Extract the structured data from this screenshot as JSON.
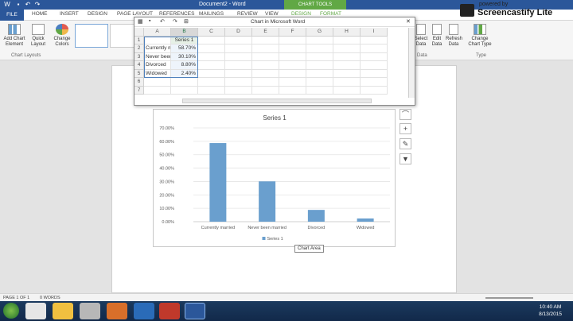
{
  "titlebar": {
    "doc_title": "Document2 - Word",
    "chart_tools": "CHART TOOLS"
  },
  "ribbon_tabs": [
    "FILE",
    "HOME",
    "INSERT",
    "DESIGN",
    "PAGE LAYOUT",
    "REFERENCES",
    "MAILINGS",
    "REVIEW",
    "VIEW",
    "DESIGN",
    "FORMAT"
  ],
  "ribbon": {
    "add_chart_element": "Add Chart Element",
    "quick_layout": "Quick Layout",
    "change_colors": "Change Colors",
    "chart_layouts_label": "Chart Layouts",
    "select_data": "Select Data",
    "edit_data": "Edit Data",
    "refresh_data": "Refresh Data",
    "data_group_label": "Data",
    "change_chart_type": "Change Chart Type",
    "type_group_label": "Type"
  },
  "spreadsheet": {
    "title": "Chart in Microsoft Word",
    "columns": [
      "A",
      "B",
      "C",
      "D",
      "E",
      "F",
      "G",
      "H",
      "I"
    ],
    "rows": [
      "1",
      "2",
      "3",
      "4",
      "5",
      "6",
      "7"
    ],
    "b1": "Series 1",
    "labels": [
      "Currently m",
      "Never been",
      "Divorced",
      "Widowed"
    ],
    "values": [
      "58.70%",
      "30.10%",
      "8.80%",
      "2.40%"
    ]
  },
  "chart_data": {
    "type": "bar",
    "title": "Series 1",
    "categories": [
      "Currently married",
      "Never been married",
      "Divorced",
      "Widowed"
    ],
    "series": [
      {
        "name": "Series 1",
        "values": [
          58.7,
          30.1,
          8.8,
          2.4
        ]
      }
    ],
    "yticks": [
      "0.00%",
      "10.00%",
      "20.00%",
      "30.00%",
      "40.00%",
      "50.00%",
      "60.00%",
      "70.00%"
    ],
    "ylim": [
      0,
      70
    ],
    "legend": "bottom",
    "grid": true,
    "bar_color": "#6a9fce"
  },
  "chart_area_tooltip": "Chart Area",
  "statusbar": {
    "page": "PAGE 1 OF 1",
    "words": "0 WORDS"
  },
  "watermark": {
    "line1": "powered by",
    "line2": "Screencastify Lite"
  },
  "clock": {
    "time": "10:40 AM",
    "date": "8/13/2015"
  },
  "colors": {
    "word_blue": "#2b579a",
    "chart_tools_green": "#61a845",
    "bar": "#6a9fce"
  }
}
